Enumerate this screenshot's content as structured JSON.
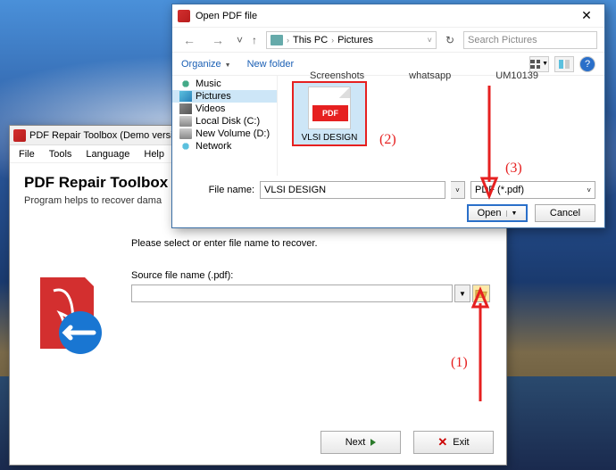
{
  "main_window": {
    "title": "PDF Repair Toolbox (Demo version)",
    "menu": [
      "File",
      "Tools",
      "Language",
      "Help"
    ],
    "heading": "PDF Repair Toolbox",
    "subheading": "Program helps to recover dama",
    "prompt": "Please select or enter file name to recover.",
    "field_label": "Source file name (.pdf):",
    "input_value": "",
    "next_btn": "Next",
    "exit_btn": "Exit"
  },
  "dialog": {
    "title": "Open PDF file",
    "path_root": "This PC",
    "path_folder": "Pictures",
    "search_placeholder": "Search Pictures",
    "organize": "Organize",
    "new_folder": "New folder",
    "tree": [
      {
        "label": "Music",
        "icon": "ic-music"
      },
      {
        "label": "Pictures",
        "icon": "ic-pic",
        "selected": true
      },
      {
        "label": "Videos",
        "icon": "ic-vid"
      },
      {
        "label": "Local Disk (C:)",
        "icon": "ic-disk"
      },
      {
        "label": "New Volume (D:)",
        "icon": "ic-disk"
      },
      {
        "label": "Network",
        "icon": "ic-net"
      }
    ],
    "folders": [
      "Screenshots",
      "whatsapp",
      "UM10139"
    ],
    "selected_file": "VLSI DESIGN",
    "file_badge": "PDF",
    "fn_label": "File name:",
    "fn_value": "VLSI DESIGN",
    "filter": "PDF (*.pdf)",
    "open_btn": "Open",
    "cancel_btn": "Cancel"
  },
  "annotations": {
    "n1": "(1)",
    "n2": "(2)",
    "n3": "(3)"
  }
}
